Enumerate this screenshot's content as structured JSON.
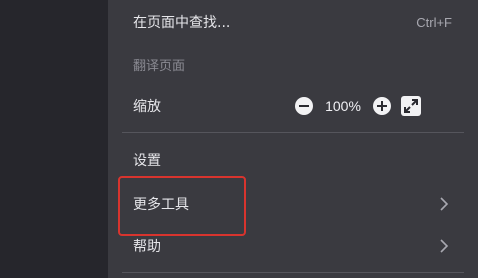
{
  "menu": {
    "find": {
      "label": "在页面中查找...",
      "shortcut": "Ctrl+F"
    },
    "translate": {
      "label": "翻译页面"
    },
    "zoom": {
      "label": "缩放",
      "value": "100%"
    },
    "settings": {
      "label": "设置"
    },
    "more_tools": {
      "label": "更多工具"
    },
    "help": {
      "label": "帮助"
    }
  },
  "colors": {
    "menu_bg": "#3a3a40",
    "page_bg": "#26262c",
    "highlight": "#d8342e",
    "text": "#e6e6ea",
    "disabled_text": "#8a8a92"
  }
}
